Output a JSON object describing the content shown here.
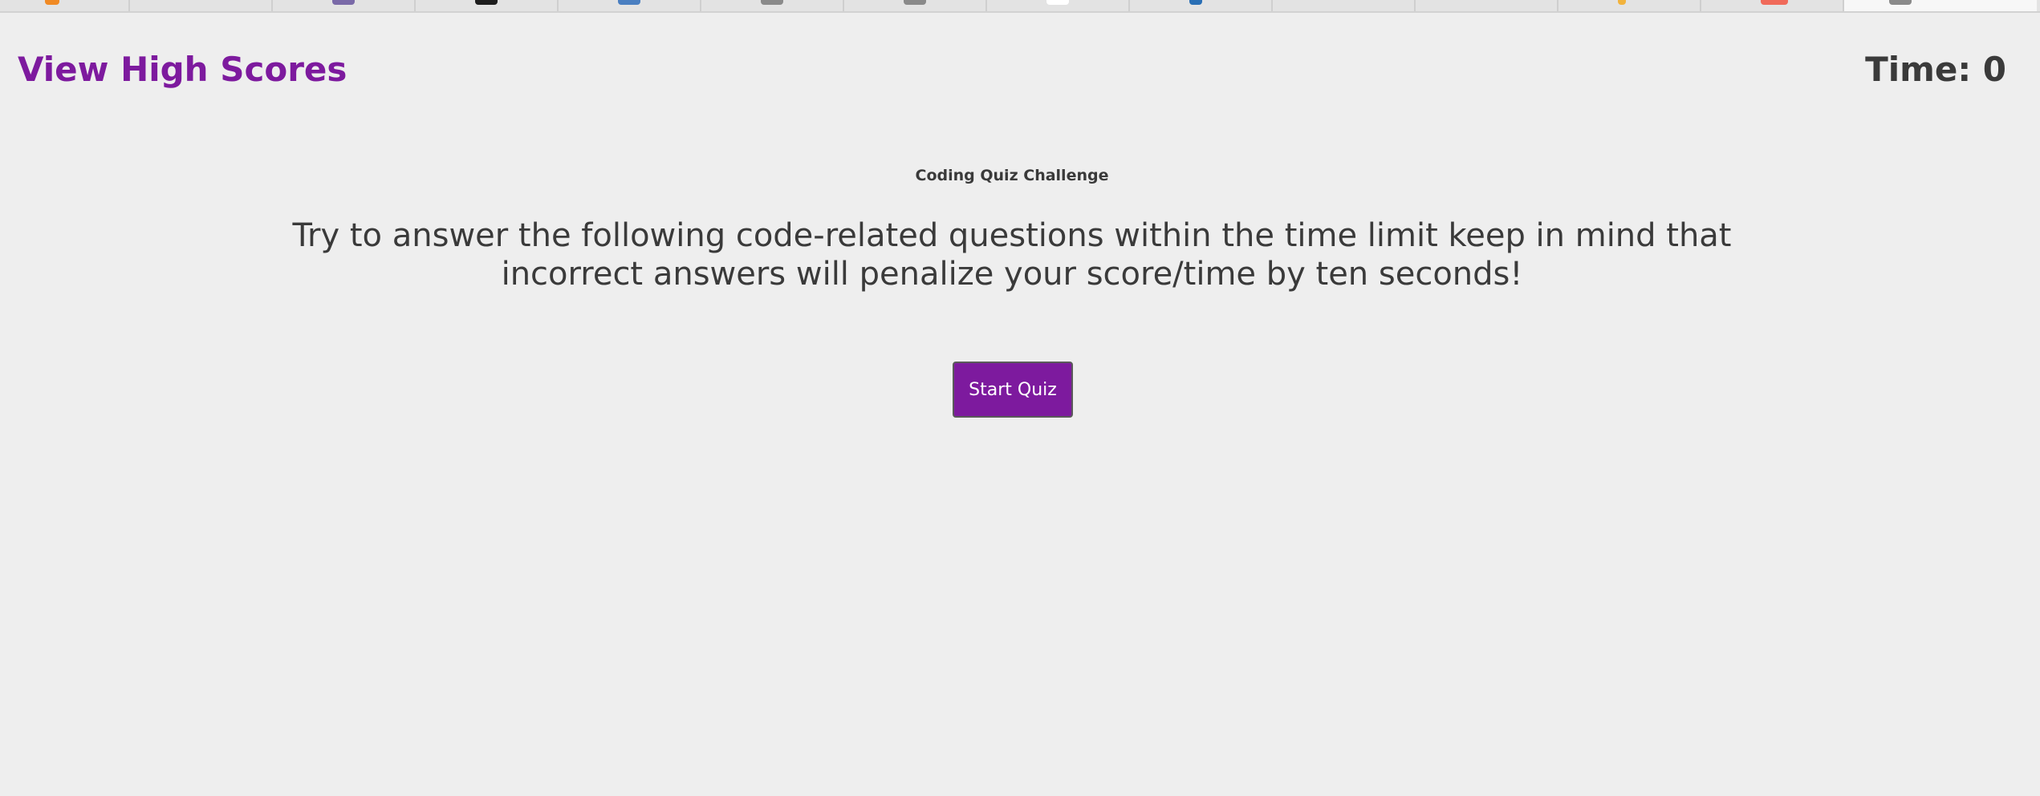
{
  "header": {
    "high_scores_link": "View High Scores",
    "timer_text": "Time: 0"
  },
  "quiz": {
    "title": "Coding Quiz Challenge",
    "description": "Try to answer the following code-related questions within the time limit keep in mind that incorrect answers will penalize your score/time by ten seconds!",
    "start_button_label": "Start Quiz"
  },
  "browser_tabs": {
    "favicon_colors": [
      "#f08a24",
      "",
      "#7a6aa8",
      "#1e1e1e",
      "#4a7fc1",
      "#8a8a8a",
      "#8a8a8a",
      "#ffffff",
      "#2a6fb5",
      "",
      "",
      "#f2b33d",
      "#f06a5a",
      "#8a8a8a"
    ]
  },
  "theme": {
    "accent": "#7d1a9e",
    "text": "#3a3a3a",
    "background": "#eeeeee"
  }
}
